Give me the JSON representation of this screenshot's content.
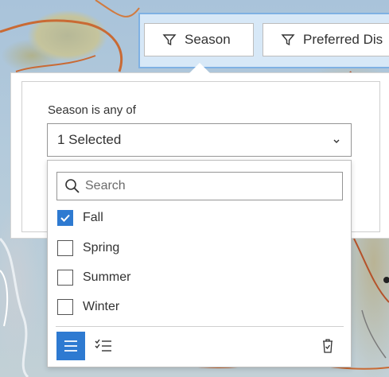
{
  "filters": {
    "season_chip_label": "Season",
    "preferred_chip_label": "Preferred Dis"
  },
  "panel": {
    "field_label": "Season is any of",
    "select_value": "1 Selected"
  },
  "dropdown": {
    "search_placeholder": "Search",
    "options": [
      {
        "label": "Fall",
        "checked": true
      },
      {
        "label": "Spring",
        "checked": false
      },
      {
        "label": "Summer",
        "checked": false
      },
      {
        "label": "Winter",
        "checked": false
      }
    ],
    "toolbar_icons": [
      "list-view-icon",
      "selected-view-icon",
      "clear-selection-icon"
    ]
  },
  "colors": {
    "accent": "#2e7ad1",
    "filter_bar_bg": "#d7e8f7",
    "filter_bar_border": "#7fb1e3"
  }
}
